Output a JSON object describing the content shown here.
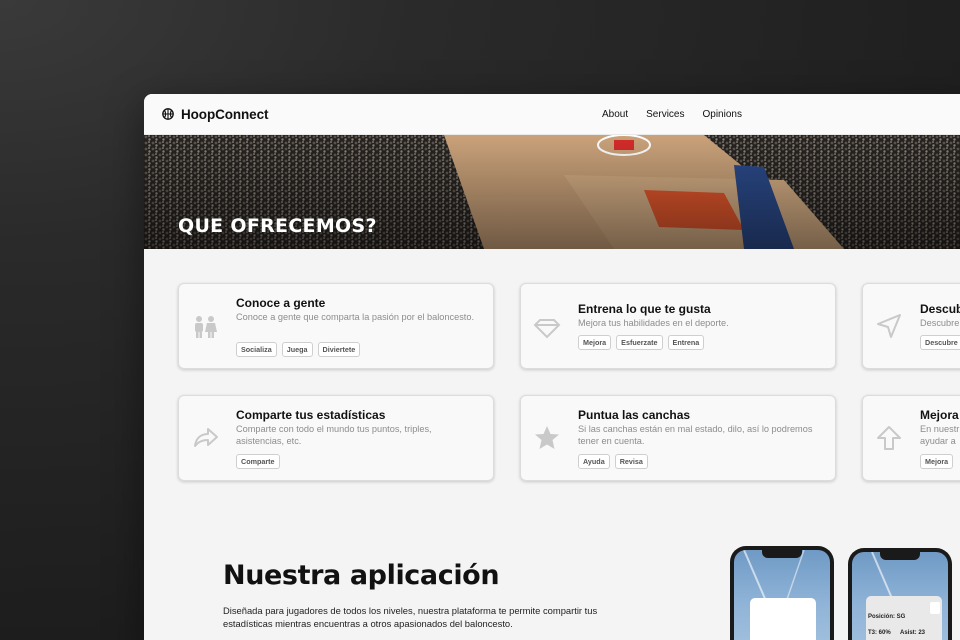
{
  "nav": {
    "brand": "HoopConnect",
    "links": [
      "About",
      "Services",
      "Opinions"
    ]
  },
  "hero": {
    "title": "QUE OFRECEMOS?"
  },
  "cards": [
    {
      "title": "Conoce a gente",
      "desc": "Conoce a gente que comparta la pasión por el baloncesto.",
      "tags": [
        "Socializa",
        "Juega",
        "Diviertete"
      ],
      "icon": "people-icon"
    },
    {
      "title": "Entrena lo que te gusta",
      "desc": "Mejora tus habilidades en el deporte.",
      "tags": [
        "Mejora",
        "Esfuerzate",
        "Entrena"
      ],
      "icon": "diamond-icon"
    },
    {
      "title": "Descub",
      "desc": "Descubre",
      "tags": [
        "Descubre"
      ],
      "icon": "navigation-icon"
    },
    {
      "title": "Comparte tus estadísticas",
      "desc": "Comparte con todo el mundo tus puntos, triples, asistencias, etc.",
      "tags": [
        "Comparte"
      ],
      "icon": "share-icon"
    },
    {
      "title": "Puntua las canchas",
      "desc": "Si las canchas están en mal estado, dilo, así lo podremos tener en cuenta.",
      "tags": [
        "Ayuda",
        "Revisa"
      ],
      "icon": "star-icon"
    },
    {
      "title": "Mejora",
      "desc": "En nuestr ayudar a",
      "tags": [
        "Mejora"
      ],
      "icon": "arrow-up-icon"
    }
  ],
  "app": {
    "title": "Nuestra aplicación",
    "desc": "Diseñada para jugadores de todos los niveles, nuestra plataforma te permite compartir tus estadísticas mientras encuentras a otros apasionados del baloncesto.",
    "phone_stats": {
      "position": "Posición: SG",
      "t3": "T3: 60%",
      "asist": "Asist: 23"
    }
  }
}
